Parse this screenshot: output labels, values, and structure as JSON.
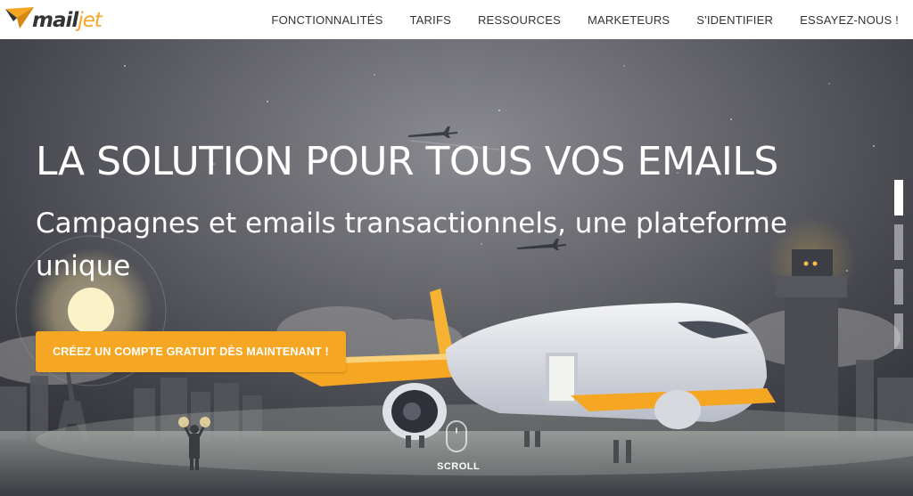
{
  "header": {
    "logo": {
      "text_main": "mail",
      "text_accent": "jet"
    },
    "nav": [
      {
        "label": "FONCTIONNALITÉS"
      },
      {
        "label": "TARIFS"
      },
      {
        "label": "RESSOURCES"
      },
      {
        "label": "MARKETEURS"
      },
      {
        "label": "S'IDENTIFIER"
      },
      {
        "label": "ESSAYEZ-NOUS !"
      }
    ]
  },
  "hero": {
    "title": "LA SOLUTION POUR TOUS VOS EMAILS",
    "subtitle": "Campagnes et emails transactionnels, une plateforme unique",
    "cta_label": "CRÉEZ UN COMPTE GRATUIT DÈS MAINTENANT !",
    "scroll_label": "SCROLL",
    "slides": {
      "count": 4,
      "active_index": 0
    }
  },
  "colors": {
    "accent": "#f5a623",
    "header_bg": "#ffffff",
    "nav_text": "#333333",
    "hero_text": "#ffffff"
  },
  "icons": [
    "mailjet-logo-icon",
    "scroll-mouse-icon"
  ]
}
